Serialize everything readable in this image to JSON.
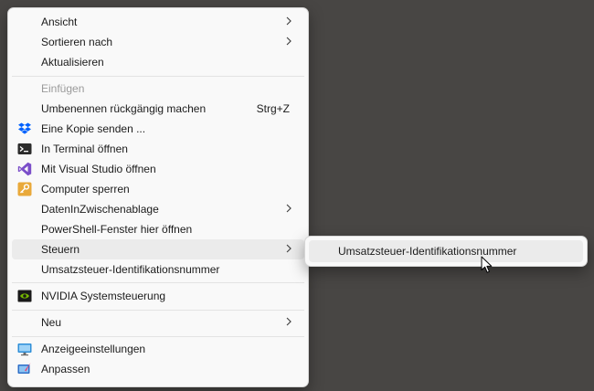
{
  "menu": {
    "items": [
      {
        "label": "Ansicht"
      },
      {
        "label": "Sortieren nach"
      },
      {
        "label": "Aktualisieren"
      },
      {
        "label": "Einfügen"
      },
      {
        "label": "Umbenennen rückgängig machen",
        "shortcut": "Strg+Z"
      },
      {
        "label": "Eine Kopie senden ...",
        "icon": "dropbox-icon"
      },
      {
        "label": "In Terminal öffnen",
        "icon": "terminal-icon"
      },
      {
        "label": "Mit Visual Studio öffnen",
        "icon": "visual-studio-icon"
      },
      {
        "label": "Computer sperren",
        "icon": "key-lock-icon"
      },
      {
        "label": "DatenInZwischenablage"
      },
      {
        "label": "PowerShell-Fenster hier öffnen"
      },
      {
        "label": "Steuern"
      },
      {
        "label": "Umsatzsteuer-Identifikationsnummer"
      },
      {
        "label": "NVIDIA Systemsteuerung",
        "icon": "nvidia-icon"
      },
      {
        "label": "Neu"
      },
      {
        "label": "Anzeigeeinstellungen",
        "icon": "display-settings-icon"
      },
      {
        "label": "Anpassen",
        "icon": "personalize-icon"
      }
    ]
  },
  "submenu": {
    "items": [
      {
        "label": "Umsatzsteuer-Identifikationsnummer"
      }
    ]
  },
  "colors": {
    "desktop": "#484644",
    "menu_bg": "#f9f9f9",
    "highlight": "#ebebeb",
    "disabled_text": "#9a9a9a"
  }
}
